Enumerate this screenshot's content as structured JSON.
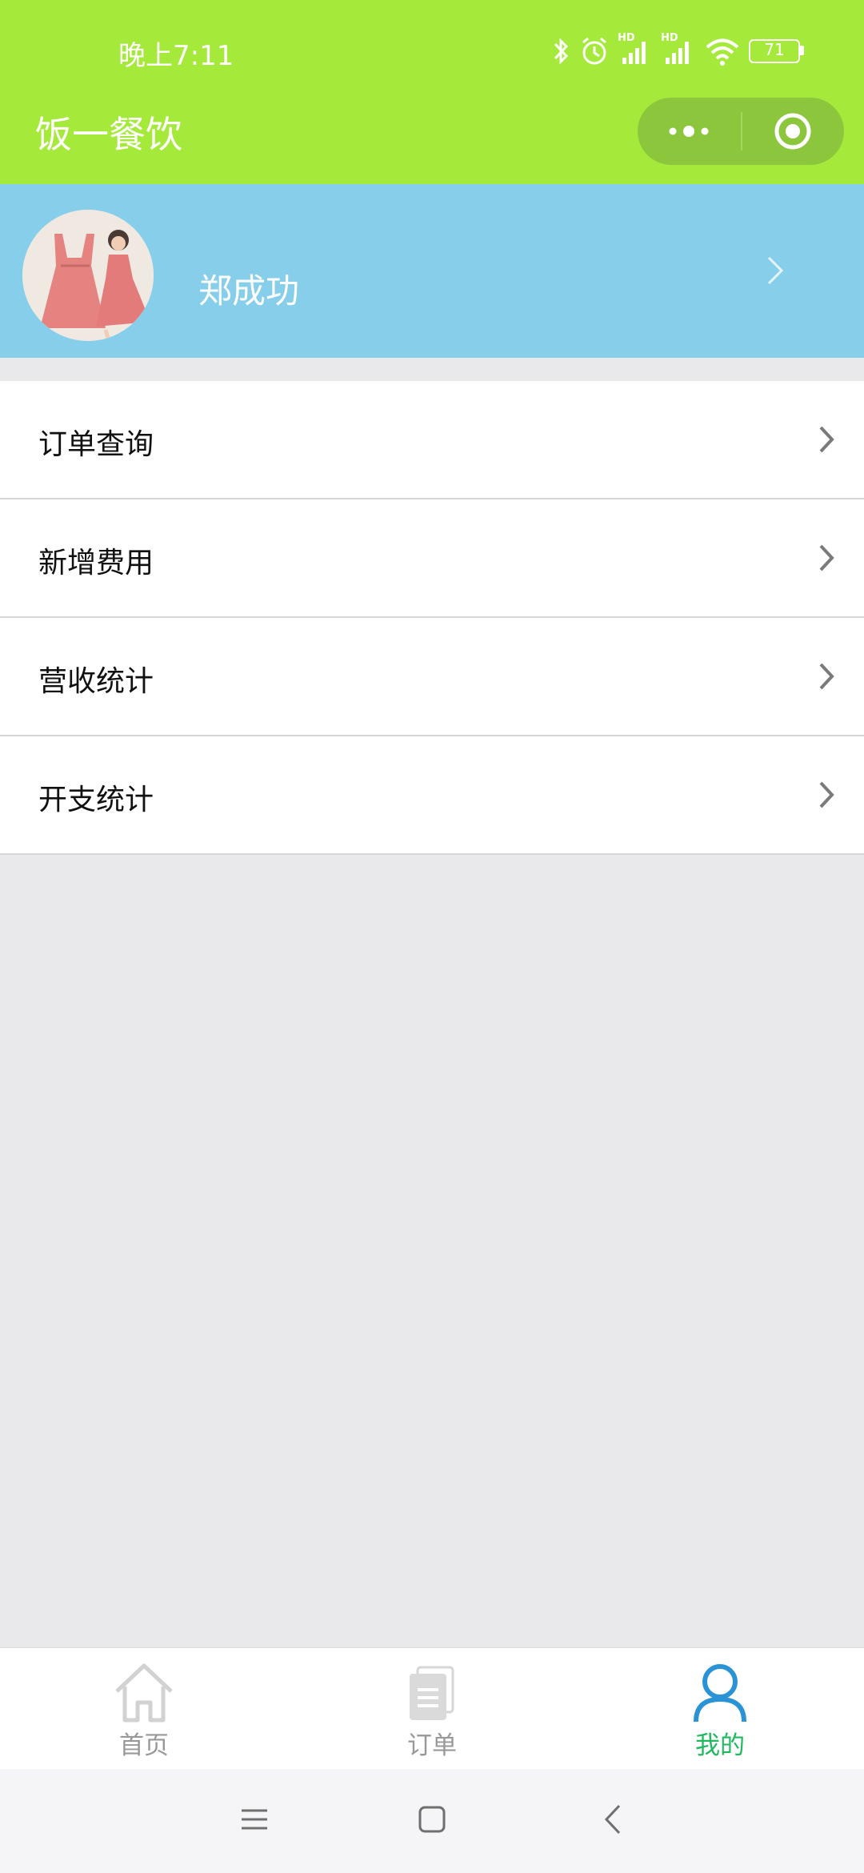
{
  "status_bar": {
    "time": "晚上7:11",
    "network_1": "HD",
    "network_2": "HD",
    "battery": "71"
  },
  "nav": {
    "title": "饭一餐饮"
  },
  "profile": {
    "name": "郑成功"
  },
  "menu": {
    "items": [
      {
        "label": "订单查询"
      },
      {
        "label": "新增费用"
      },
      {
        "label": "营收统计"
      },
      {
        "label": "开支统计"
      }
    ]
  },
  "tabbar": {
    "tabs": [
      {
        "label": "首页",
        "icon": "home-icon",
        "active": false
      },
      {
        "label": "订单",
        "icon": "document-icon",
        "active": false
      },
      {
        "label": "我的",
        "icon": "user-icon",
        "active": true
      }
    ],
    "active_color": "#21b860",
    "inactive_color": "#999999"
  },
  "colors": {
    "nav_background": "#a5e93a",
    "profile_background": "#87ceeb",
    "page_background": "#e9e9eb"
  }
}
